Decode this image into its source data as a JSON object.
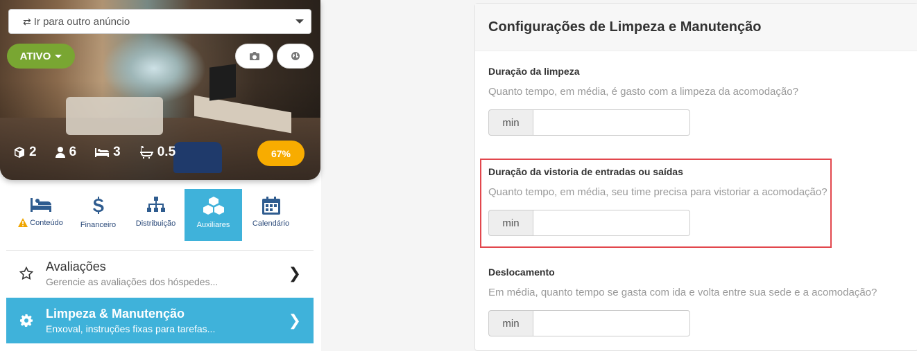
{
  "listing": {
    "goto_placeholder": "Ir para outro anúncio",
    "status_label": "ATIVO",
    "stats": {
      "units": "2",
      "guests": "6",
      "beds": "3",
      "baths": "0.5"
    },
    "completion": "67%"
  },
  "tabs": [
    {
      "label": "Conteúdo",
      "icon": "bed-icon",
      "warning": true
    },
    {
      "label": "Financeiro",
      "icon": "dollar-icon"
    },
    {
      "label": "Distribuição",
      "icon": "sitemap-icon"
    },
    {
      "label": "Auxiliares",
      "icon": "cubes-icon",
      "active": true
    },
    {
      "label": "Calendário",
      "icon": "calendar-icon"
    }
  ],
  "menu": [
    {
      "title": "Avaliações",
      "subtitle": "Gerencie as avaliações dos hóspedes...",
      "icon": "star-icon"
    },
    {
      "title": "Limpeza & Manutenção",
      "subtitle": "Enxoval, instruções fixas para tarefas...",
      "icon": "gear-icon",
      "active": true
    }
  ],
  "panel": {
    "title": "Configurações de Limpeza e Manutenção",
    "fields": [
      {
        "label": "Duração da limpeza",
        "help": "Quanto tempo, em média, é gasto com a limpeza da acomodação?",
        "unit": "min",
        "value": ""
      },
      {
        "label": "Duração da vistoria de entradas ou saídas",
        "help": "Quanto tempo, em média, seu time precisa para vistoriar a acomodação?",
        "unit": "min",
        "value": ""
      },
      {
        "label": "Deslocamento",
        "help": "Em média, quanto tempo se gasta com ida e volta entre sua sede e a acomodação?",
        "unit": "min",
        "value": ""
      }
    ]
  },
  "colors": {
    "accent": "#3fb2da",
    "status_green": "#79a632",
    "badge_orange": "#f8ac00",
    "highlight_red": "#e2474d",
    "icon_blue": "#2f5c8f"
  }
}
